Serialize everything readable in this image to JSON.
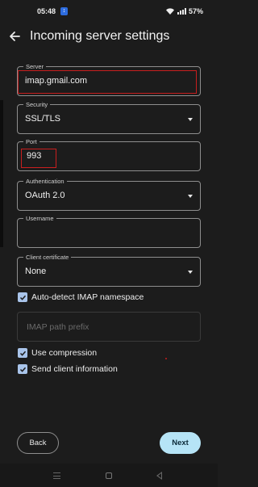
{
  "status_bar": {
    "time": "05:48",
    "notification_badge": "↕",
    "battery": "57%",
    "icons": [
      "wifi-icon",
      "signal-icon"
    ]
  },
  "app_bar": {
    "title": "Incoming server settings",
    "back_icon": "back-arrow-icon"
  },
  "form": {
    "server": {
      "label": "Server",
      "value": "imap.gmail.com"
    },
    "security": {
      "label": "Security",
      "value": "SSL/TLS"
    },
    "port": {
      "label": "Port",
      "value": "993"
    },
    "authentication": {
      "label": "Authentication",
      "value": "OAuth 2.0"
    },
    "username": {
      "label": "Username",
      "value": ""
    },
    "client_certificate": {
      "label": "Client certificate",
      "value": "None"
    },
    "auto_detect_namespace": {
      "label": "Auto-detect IMAP namespace",
      "checked": true
    },
    "imap_path_prefix": {
      "placeholder": "IMAP path prefix",
      "value": ""
    },
    "use_compression": {
      "label": "Use compression",
      "checked": true
    },
    "send_client_info": {
      "label": "Send client information",
      "checked": true
    }
  },
  "buttons": {
    "back": "Back",
    "next": "Next"
  },
  "colors": {
    "background": "#1c1c1c",
    "accent": "#b6e4f6",
    "checkbox": "#a9c4ea",
    "highlight": "#c81e1e"
  }
}
